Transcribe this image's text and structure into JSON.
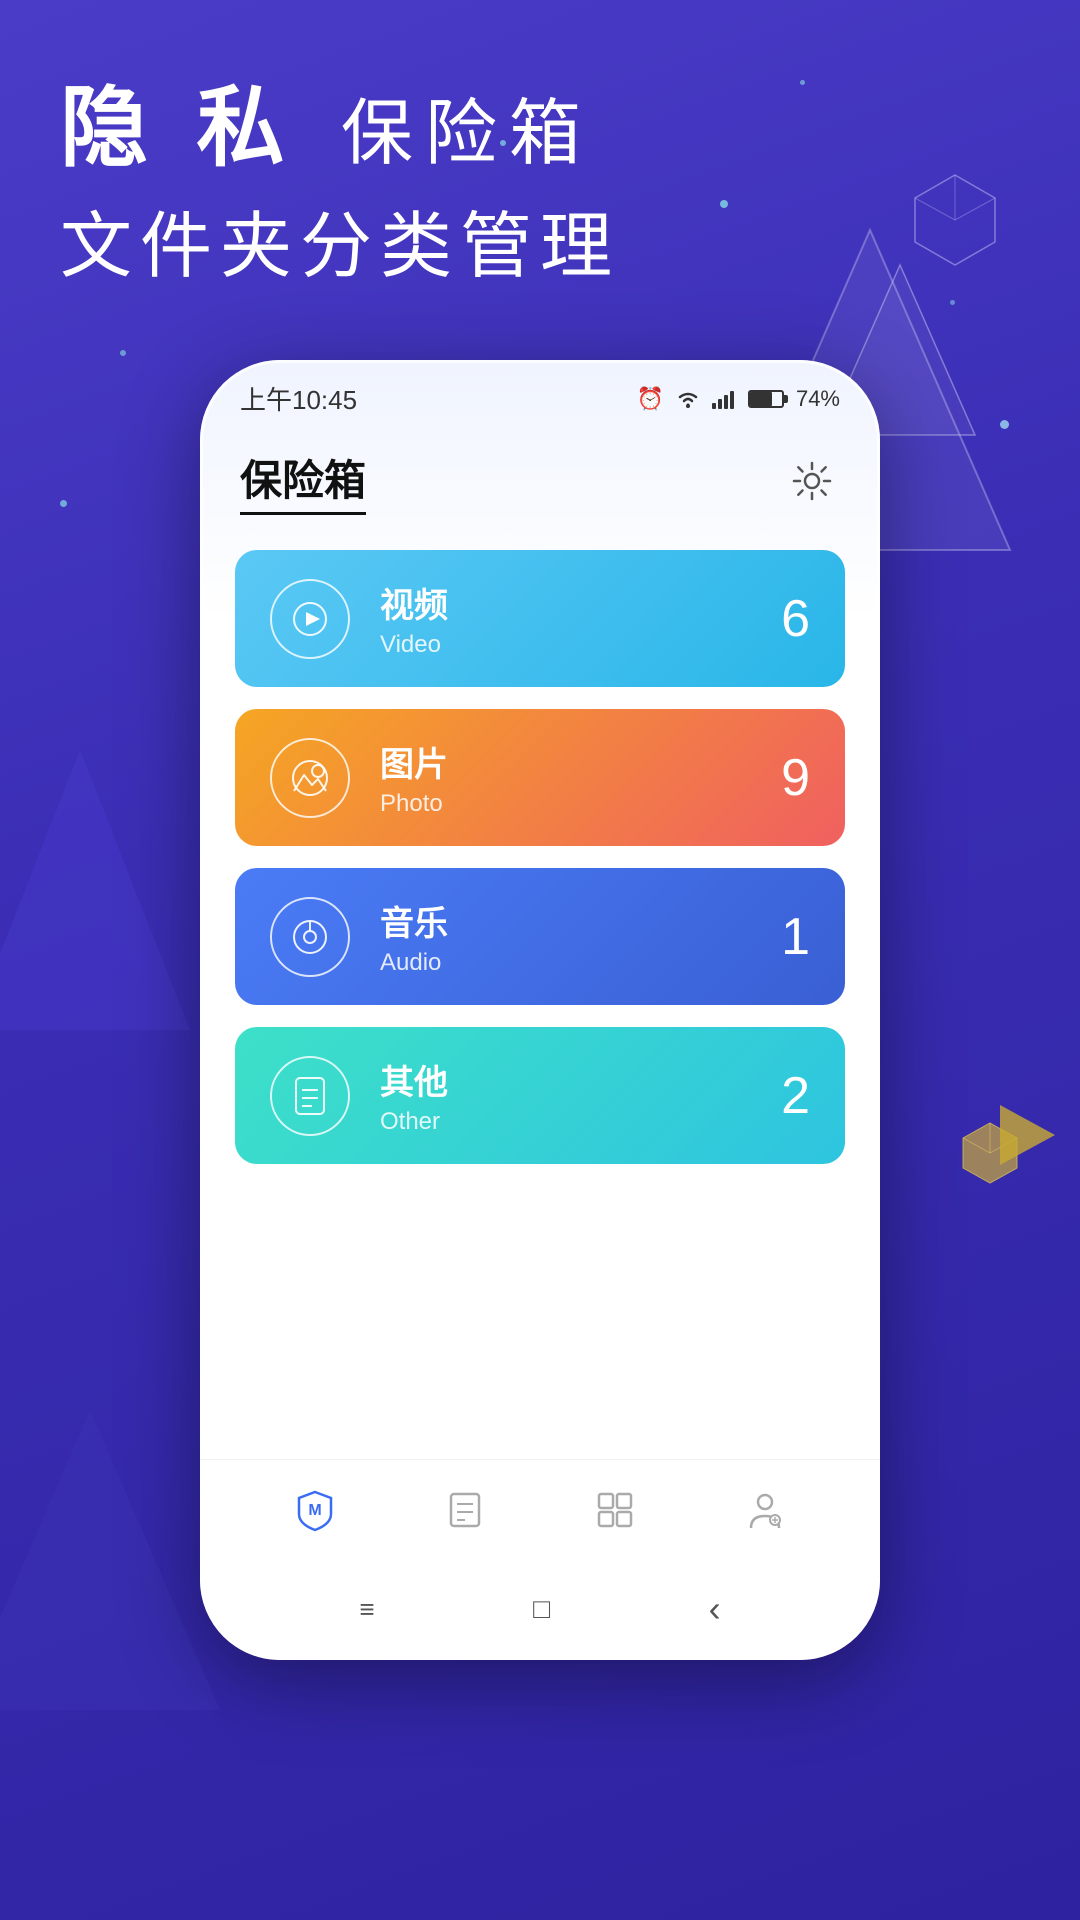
{
  "page": {
    "background_color_start": "#4a3cc7",
    "background_color_end": "#2e22a0"
  },
  "header": {
    "line1_part1": "隐 私",
    "line1_part2": "保险箱",
    "line2": "文件夹分类管理"
  },
  "status_bar": {
    "time": "上午10:45",
    "battery_percent": "74%"
  },
  "app": {
    "title": "保险箱",
    "settings_icon": "⚙"
  },
  "categories": [
    {
      "name_cn": "视频",
      "name_en": "Video",
      "count": "6",
      "icon": "▶",
      "color_class": "card-video"
    },
    {
      "name_cn": "图片",
      "name_en": "Photo",
      "count": "9",
      "icon": "🏔",
      "color_class": "card-photo"
    },
    {
      "name_cn": "音乐",
      "name_en": "Audio",
      "count": "1",
      "icon": "♪",
      "color_class": "card-audio"
    },
    {
      "name_cn": "其他",
      "name_en": "Other",
      "count": "2",
      "icon": "📄",
      "color_class": "card-other"
    }
  ],
  "bottom_nav": {
    "items": [
      {
        "icon": "shield",
        "label": "safe",
        "active": true
      },
      {
        "icon": "list",
        "label": "files",
        "active": false
      },
      {
        "icon": "apps",
        "label": "apps",
        "active": false
      },
      {
        "icon": "person",
        "label": "profile",
        "active": false
      }
    ]
  },
  "sys_nav": {
    "menu": "≡",
    "home": "□",
    "back": "‹"
  }
}
